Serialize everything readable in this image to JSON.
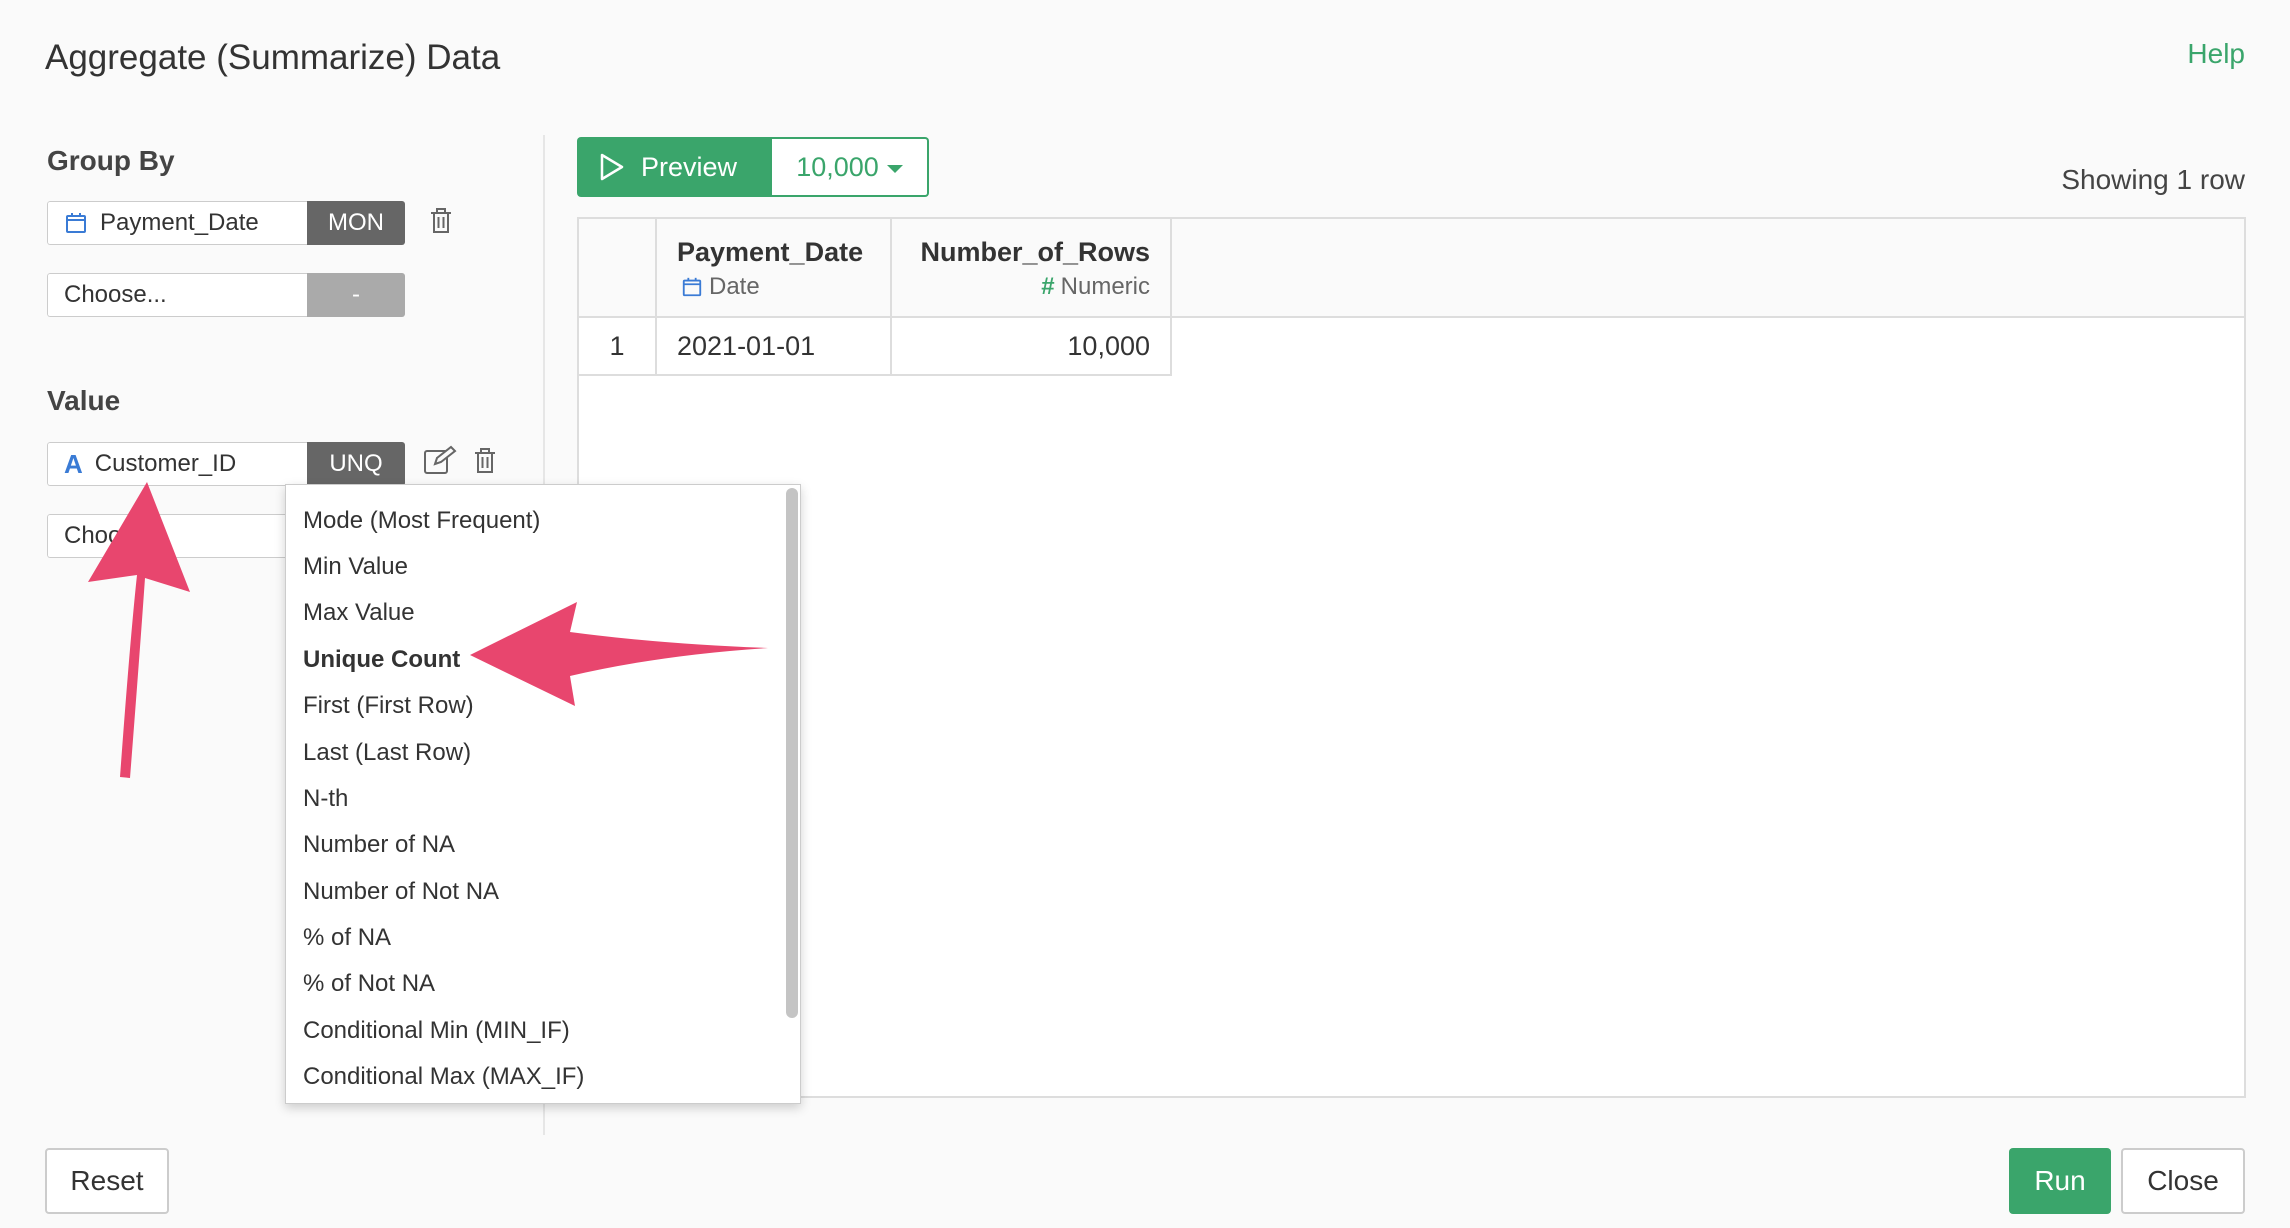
{
  "header": {
    "title": "Aggregate (Summarize) Data",
    "help_label": "Help"
  },
  "group_by": {
    "label": "Group By",
    "fields": [
      {
        "name": "Payment_Date",
        "tag": "MON",
        "icon": "calendar-icon"
      },
      {
        "name": "Choose...",
        "tag": "-"
      }
    ]
  },
  "value": {
    "label": "Value",
    "fields": [
      {
        "name": "Customer_ID",
        "tag": "UNQ",
        "icon": "character-type-icon",
        "type_glyph": "A"
      },
      {
        "name": "Choose..."
      }
    ]
  },
  "preview": {
    "label": "Preview",
    "row_limit": "10,000",
    "showing": "Showing 1 row"
  },
  "table": {
    "columns": [
      {
        "name": "Payment_Date",
        "type": "Date",
        "icon": "calendar-icon"
      },
      {
        "name": "Number_of_Rows",
        "type": "Numeric",
        "icon": "hash-icon",
        "type_glyph": "#"
      }
    ],
    "rows": [
      {
        "index": "1",
        "cells": [
          "2021-01-01",
          "10,000"
        ]
      }
    ]
  },
  "dropdown": {
    "selected": "Unique Count",
    "items": [
      "Mode (Most Frequent)",
      "Min Value",
      "Max Value",
      "Unique Count",
      "First (First Row)",
      "Last (Last Row)",
      "N-th",
      "Number of NA",
      "Number of Not NA",
      "% of NA",
      "% of Not NA",
      "Conditional Min (MIN_IF)",
      "Conditional Max (MAX_IF)"
    ]
  },
  "footer": {
    "reset_label": "Reset",
    "run_label": "Run",
    "close_label": "Close"
  },
  "colors": {
    "accent": "#3aa56b",
    "annotation_arrow": "#e8466e",
    "tag_dark": "#666666",
    "tag_light": "#aaaaaa",
    "type_icon": "#3a7bd5"
  }
}
